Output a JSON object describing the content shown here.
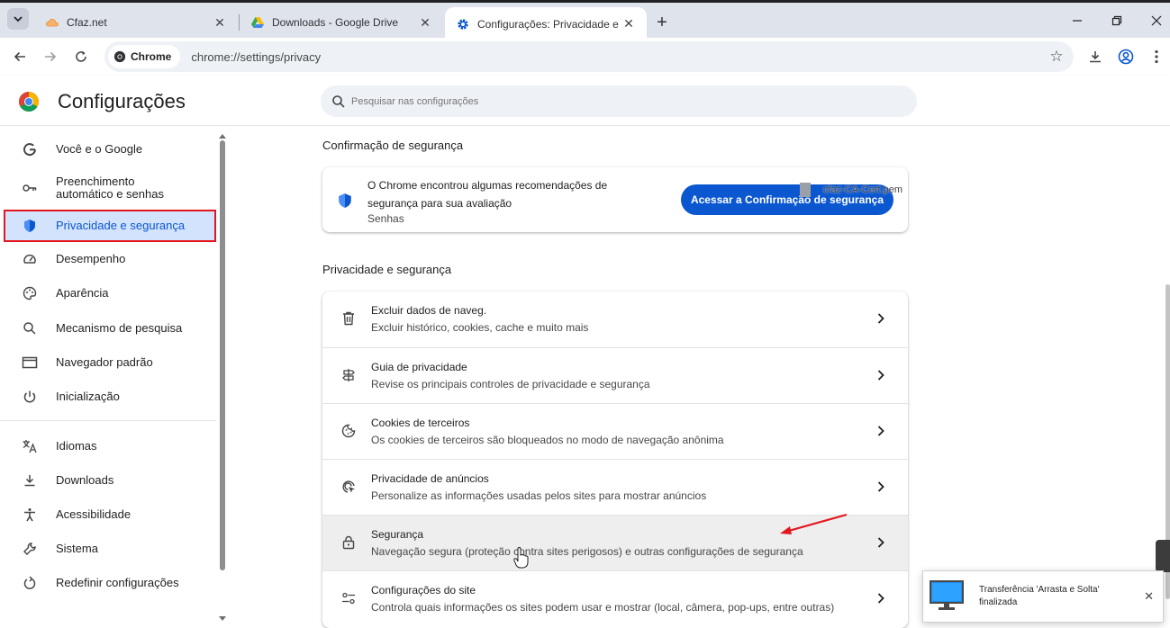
{
  "browser": {
    "tabs": [
      {
        "title": "Cfaz.net",
        "icon": "cloud-icon",
        "active": false
      },
      {
        "title": "Downloads - Google Drive",
        "icon": "google-drive-icon",
        "active": false
      },
      {
        "title": "Configurações: Privacidade e se",
        "icon": "settings-gear-icon",
        "active": true
      }
    ],
    "new_tab_label": "+",
    "address_chip": "Chrome",
    "url": "chrome://settings/privacy"
  },
  "settings": {
    "title": "Configurações",
    "search_placeholder": "Pesquisar nas configurações"
  },
  "sidebar": {
    "items": [
      {
        "label": "Você e o Google",
        "icon": "google-g-icon"
      },
      {
        "label": "Preenchimento automático e senhas",
        "icon": "key-icon"
      },
      {
        "label": "Privacidade e segurança",
        "icon": "shield-icon",
        "selected": true
      },
      {
        "label": "Desempenho",
        "icon": "speedometer-icon"
      },
      {
        "label": "Aparência",
        "icon": "palette-icon"
      },
      {
        "label": "Mecanismo de pesquisa",
        "icon": "search-icon"
      },
      {
        "label": "Navegador padrão",
        "icon": "browser-window-icon"
      },
      {
        "label": "Inicialização",
        "icon": "power-icon"
      },
      {
        "label": "Idiomas",
        "icon": "translate-icon"
      },
      {
        "label": "Downloads",
        "icon": "download-icon"
      },
      {
        "label": "Acessibilidade",
        "icon": "accessibility-icon"
      },
      {
        "label": "Sistema",
        "icon": "wrench-icon"
      },
      {
        "label": "Redefinir configurações",
        "icon": "reset-icon"
      }
    ]
  },
  "safety_check": {
    "section_title": "Confirmação de segurança",
    "message": "O Chrome encontrou algumas recomendações de segurança para sua avaliação",
    "subtitle": "Senhas",
    "button_label": "Acessar a Confirmação de segurança",
    "drag_file_name": "cfaz-CA-Cert.pem"
  },
  "privacy": {
    "section_title": "Privacidade e segurança",
    "rows": [
      {
        "title": "Excluir dados de naveg.",
        "subtitle": "Excluir histórico, cookies, cache e muito mais",
        "icon": "trash-icon"
      },
      {
        "title": "Guia de privacidade",
        "subtitle": "Revise os principais controles de privacidade e segurança",
        "icon": "signpost-icon"
      },
      {
        "title": "Cookies de terceiros",
        "subtitle": "Os cookies de terceiros são bloqueados no modo de navegação anônima",
        "icon": "cookie-icon"
      },
      {
        "title": "Privacidade de anúncios",
        "subtitle": "Personalize as informações usadas pelos sites para mostrar anúncios",
        "icon": "ad-target-icon"
      },
      {
        "title": "Segurança",
        "subtitle": "Navegação segura (proteção contra sites perigosos) e outras configurações de segurança",
        "icon": "lock-icon",
        "hover": true
      },
      {
        "title": "Configurações do site",
        "subtitle": "Controla quais informações os sites podem usar e mostrar (local, câmera, pop-ups, entre outras)",
        "icon": "sliders-icon"
      }
    ]
  },
  "notification": {
    "text": "Transferência 'Arrasta e Solta' finalizada",
    "icon": "monitor-icon"
  },
  "colors": {
    "accent": "#0b57d0",
    "selected_bg": "#d3e3fd",
    "highlight_box": "#e3161e",
    "annotation_arrow": "#e3161e"
  }
}
